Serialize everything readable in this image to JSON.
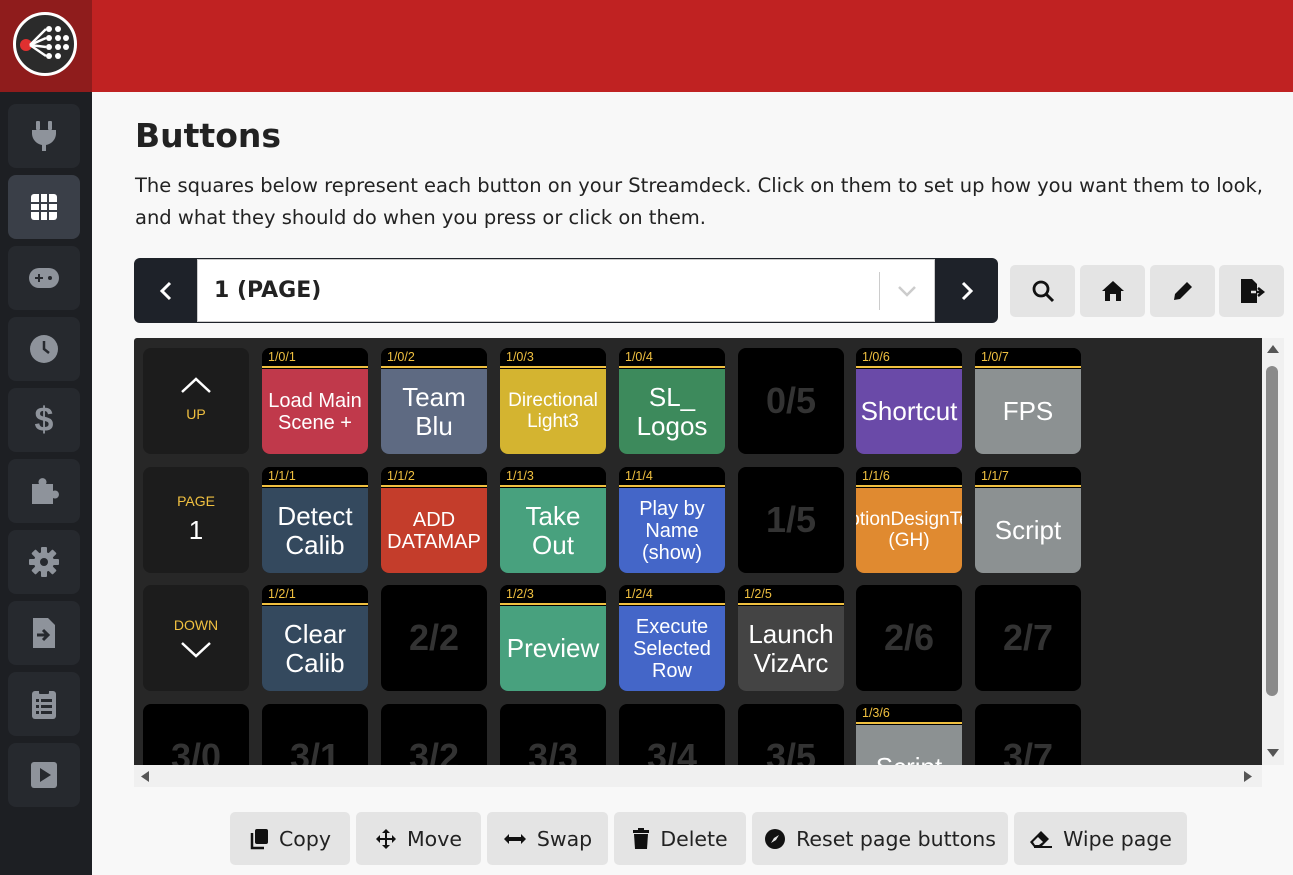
{
  "page": {
    "title": "Buttons",
    "description": "The squares below represent each button on your Streamdeck. Click on them to set up how you want them to look, and what they should do when you press or click on them."
  },
  "pager": {
    "current": "1 (PAGE)"
  },
  "sidebar": {
    "items": [
      {
        "icon": "plug-icon"
      },
      {
        "icon": "grid-icon",
        "active": true
      },
      {
        "icon": "gamepad-icon"
      },
      {
        "icon": "clock-icon"
      },
      {
        "icon": "dollar-icon"
      },
      {
        "icon": "puzzle-icon"
      },
      {
        "icon": "gear-icon"
      },
      {
        "icon": "file-import-icon"
      },
      {
        "icon": "clipboard-list-icon"
      },
      {
        "icon": "play-square-icon"
      }
    ]
  },
  "nav": {
    "up": "UP",
    "page_label": "PAGE",
    "page_num": "1",
    "down": "DOWN"
  },
  "grid": {
    "rows": [
      [
        {
          "id": "1/0/1",
          "text": "Load Main Scene +",
          "bg": "#c0394b",
          "size": 20
        },
        {
          "id": "1/0/2",
          "text": "Team Blu",
          "bg": "#5e6a82",
          "size": 26
        },
        {
          "id": "1/0/3",
          "text": "Directional Light3",
          "bg": "#d4b430",
          "size": 19
        },
        {
          "id": "1/0/4",
          "text": "SL_ Logos",
          "bg": "#3d8a5c",
          "size": 26
        },
        {
          "empty": "0/5"
        },
        {
          "id": "1/0/6",
          "text": "Shortcut",
          "bg": "#6a4aa8",
          "size": 26
        },
        {
          "id": "1/0/7",
          "text": "FPS",
          "bg": "#8c9192",
          "size": 26
        }
      ],
      [
        {
          "id": "1/1/1",
          "text": "Detect Calib",
          "bg": "#34495e",
          "size": 26
        },
        {
          "id": "1/1/2",
          "text": "ADD DATAMAP",
          "bg": "#c43d2b",
          "size": 20
        },
        {
          "id": "1/1/3",
          "text": "Take Out",
          "bg": "#48a17e",
          "size": 26
        },
        {
          "id": "1/1/4",
          "text": "Play by Name (show)",
          "bg": "#4466c8",
          "size": 20
        },
        {
          "empty": "1/5"
        },
        {
          "id": "1/1/6",
          "text": "MotionDesignTest (GH)",
          "bg": "#e08a30",
          "size": 19
        },
        {
          "id": "1/1/7",
          "text": "Script",
          "bg": "#8c9192",
          "size": 26
        }
      ],
      [
        {
          "id": "1/2/1",
          "text": "Clear Calib",
          "bg": "#34495e",
          "size": 26
        },
        {
          "empty": "2/2"
        },
        {
          "id": "1/2/3",
          "text": "Preview",
          "bg": "#48a17e",
          "size": 26
        },
        {
          "id": "1/2/4",
          "text": "Execute Selected Row",
          "bg": "#4466c8",
          "size": 20
        },
        {
          "id": "1/2/5",
          "text": "Launch VizArc",
          "bg": "#444444",
          "size": 26
        },
        {
          "empty": "2/6"
        },
        {
          "empty": "2/7"
        }
      ],
      [
        {
          "empty": "3/0"
        },
        {
          "empty": "3/1"
        },
        {
          "empty": "3/2"
        },
        {
          "empty": "3/3"
        },
        {
          "empty": "3/4"
        },
        {
          "empty": "3/5"
        },
        {
          "id": "1/3/6",
          "text": "Script",
          "bg": "#8c9192",
          "size": 26
        },
        {
          "empty": "3/7"
        }
      ]
    ]
  },
  "actions": {
    "copy": "Copy",
    "move": "Move",
    "swap": "Swap",
    "delete": "Delete",
    "reset": "Reset page buttons",
    "wipe": "Wipe page"
  },
  "colors": {
    "topbar": "#c02222",
    "sidebar": "#1d1f23",
    "accent": "#f0c040"
  }
}
